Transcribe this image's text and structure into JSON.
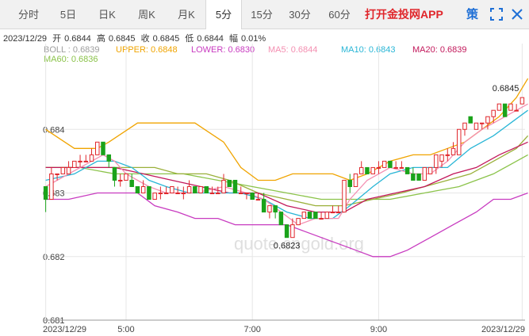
{
  "toolbar": {
    "tabs": [
      "分时",
      "5日",
      "日K",
      "周K",
      "月K",
      "5分",
      "15分",
      "30分",
      "60分"
    ],
    "active_tab": "5分",
    "app_link": "打开金投网APP",
    "more_label": "策",
    "icons": [
      "fullscreen-icon",
      "close-icon"
    ]
  },
  "quote": {
    "date": "2023/12/29",
    "open_label": "开",
    "open": "0.6844",
    "high_label": "高",
    "high": "0.6845",
    "close_label": "收",
    "close": "0.6845",
    "low_label": "低",
    "low": "0.6844",
    "change_label": "幅",
    "change": "0.01%"
  },
  "indicators": {
    "boll": "BOLL : 0.6839",
    "upper": "UPPER: 0.6848",
    "lower": "LOWER: 0.6830",
    "ma5": "MA5: 0.6844",
    "ma10": "MA10: 0.6843",
    "ma20": "MA20: 0.6839",
    "ma60": "MA60: 0.6836"
  },
  "watermark": "quote.cngold.org",
  "colors": {
    "up": "#e0262b",
    "down": "#1aa31a",
    "upper": "#f0a400",
    "lower": "#c83bc0",
    "boll": "#9ab03a",
    "ma5": "#f48fb1",
    "ma10": "#29b6d6",
    "ma20": "#c2185b",
    "ma60": "#8bc34a",
    "grid": "#e6e6e6",
    "accent": "#e0262b",
    "brand": "#1e6fd6"
  },
  "chart_data": {
    "type": "candlestick",
    "y_ticks": [
      0.681,
      0.682,
      0.683,
      0.684
    ],
    "ylim": [
      0.681,
      0.6851
    ],
    "x_ticks": [
      "2023/12/29",
      "5:00",
      "7:00",
      "9:00",
      "2023/12/29"
    ],
    "max_label": "0.6845",
    "min_label": "0.6823",
    "candles": [
      [
        0.6831,
        0.6831,
        0.6827,
        0.6829
      ],
      [
        0.6829,
        0.6834,
        0.6829,
        0.6833
      ],
      [
        0.6833,
        0.6833,
        0.6832,
        0.6833
      ],
      [
        0.6833,
        0.6834,
        0.6833,
        0.6834
      ],
      [
        0.6833,
        0.6835,
        0.6833,
        0.6834
      ],
      [
        0.6834,
        0.6835,
        0.6834,
        0.6835
      ],
      [
        0.6835,
        0.6836,
        0.6834,
        0.6835
      ],
      [
        0.6835,
        0.6836,
        0.6835,
        0.6835
      ],
      [
        0.6835,
        0.6837,
        0.6835,
        0.6836
      ],
      [
        0.6836,
        0.6838,
        0.6836,
        0.6838
      ],
      [
        0.6838,
        0.6838,
        0.6836,
        0.6836
      ],
      [
        0.6836,
        0.6835,
        0.6834,
        0.6835
      ],
      [
        0.6834,
        0.6834,
        0.6831,
        0.6832
      ],
      [
        0.6832,
        0.6833,
        0.6831,
        0.6832
      ],
      [
        0.6832,
        0.6833,
        0.6832,
        0.6833
      ],
      [
        0.6832,
        0.6833,
        0.6831,
        0.6831
      ],
      [
        0.6831,
        0.6831,
        0.683,
        0.683
      ],
      [
        0.683,
        0.6832,
        0.683,
        0.6831
      ],
      [
        0.6831,
        0.6831,
        0.6829,
        0.6829
      ],
      [
        0.6829,
        0.683,
        0.6829,
        0.683
      ],
      [
        0.683,
        0.6831,
        0.6829,
        0.683
      ],
      [
        0.683,
        0.6831,
        0.683,
        0.683
      ],
      [
        0.683,
        0.6831,
        0.683,
        0.6831
      ],
      [
        0.683,
        0.6831,
        0.683,
        0.683
      ],
      [
        0.683,
        0.6831,
        0.6829,
        0.683
      ],
      [
        0.683,
        0.6832,
        0.683,
        0.6831
      ],
      [
        0.6831,
        0.6831,
        0.683,
        0.683
      ],
      [
        0.683,
        0.6831,
        0.683,
        0.6831
      ],
      [
        0.6831,
        0.6831,
        0.683,
        0.683
      ],
      [
        0.683,
        0.6831,
        0.683,
        0.683
      ],
      [
        0.683,
        0.6831,
        0.683,
        0.683
      ],
      [
        0.683,
        0.6833,
        0.683,
        0.6832
      ],
      [
        0.6832,
        0.6832,
        0.6831,
        0.6831
      ],
      [
        0.6832,
        0.6832,
        0.683,
        0.683
      ],
      [
        0.683,
        0.6831,
        0.683,
        0.683
      ],
      [
        0.683,
        0.683,
        0.6829,
        0.683
      ],
      [
        0.683,
        0.683,
        0.6829,
        0.6829
      ],
      [
        0.6829,
        0.683,
        0.6829,
        0.6829
      ],
      [
        0.6829,
        0.683,
        0.6827,
        0.6827
      ],
      [
        0.6827,
        0.6828,
        0.6826,
        0.6828
      ],
      [
        0.6828,
        0.6828,
        0.6826,
        0.6827
      ],
      [
        0.6827,
        0.6827,
        0.6825,
        0.6825
      ],
      [
        0.6825,
        0.6825,
        0.6823,
        0.6823
      ],
      [
        0.6823,
        0.6826,
        0.6823,
        0.6825
      ],
      [
        0.6825,
        0.6826,
        0.6825,
        0.6826
      ],
      [
        0.6826,
        0.6827,
        0.6826,
        0.6827
      ],
      [
        0.6827,
        0.6827,
        0.6826,
        0.6826
      ],
      [
        0.6827,
        0.6827,
        0.6826,
        0.6826
      ],
      [
        0.6826,
        0.6827,
        0.6826,
        0.6826
      ],
      [
        0.6826,
        0.6827,
        0.6826,
        0.6827
      ],
      [
        0.6827,
        0.6828,
        0.6827,
        0.6827
      ],
      [
        0.6827,
        0.6828,
        0.6827,
        0.6827
      ],
      [
        0.6827,
        0.6832,
        0.6827,
        0.6832
      ],
      [
        0.6832,
        0.6833,
        0.683,
        0.6831
      ],
      [
        0.6831,
        0.6833,
        0.6831,
        0.6833
      ],
      [
        0.6833,
        0.6835,
        0.6833,
        0.6834
      ],
      [
        0.6834,
        0.6834,
        0.6833,
        0.6833
      ],
      [
        0.6833,
        0.6834,
        0.6833,
        0.6834
      ],
      [
        0.6834,
        0.6835,
        0.6833,
        0.6834
      ],
      [
        0.6834,
        0.6835,
        0.6834,
        0.6835
      ],
      [
        0.6835,
        0.6835,
        0.6834,
        0.6834
      ],
      [
        0.6834,
        0.6835,
        0.6834,
        0.6834
      ],
      [
        0.6834,
        0.6835,
        0.6834,
        0.6834
      ],
      [
        0.6834,
        0.6834,
        0.6833,
        0.6833
      ],
      [
        0.6833,
        0.6834,
        0.6832,
        0.6832
      ],
      [
        0.6833,
        0.6833,
        0.6832,
        0.6832
      ],
      [
        0.6832,
        0.6834,
        0.6832,
        0.6834
      ],
      [
        0.6833,
        0.6834,
        0.6833,
        0.6834
      ],
      [
        0.6834,
        0.6836,
        0.6833,
        0.6836
      ],
      [
        0.6835,
        0.6836,
        0.6834,
        0.6836
      ],
      [
        0.6836,
        0.6837,
        0.6835,
        0.6836
      ],
      [
        0.6836,
        0.6838,
        0.6836,
        0.6837
      ],
      [
        0.6836,
        0.684,
        0.6836,
        0.684
      ],
      [
        0.684,
        0.6841,
        0.6839,
        0.6841
      ],
      [
        0.6842,
        0.6842,
        0.6841,
        0.6841
      ],
      [
        0.684,
        0.6841,
        0.684,
        0.6841
      ],
      [
        0.6841,
        0.6841,
        0.684,
        0.6841
      ],
      [
        0.6841,
        0.6842,
        0.684,
        0.6842
      ],
      [
        0.6842,
        0.6843,
        0.6841,
        0.6843
      ],
      [
        0.6843,
        0.6844,
        0.6843,
        0.6844
      ],
      [
        0.6844,
        0.6844,
        0.6842,
        0.6842
      ],
      [
        0.6843,
        0.6844,
        0.6843,
        0.6844
      ],
      [
        0.6843,
        0.6844,
        0.6843,
        0.6843
      ],
      [
        0.6844,
        0.6845,
        0.6844,
        0.6845
      ]
    ],
    "upper": [
      [
        0,
        0.684
      ],
      [
        5,
        0.6837
      ],
      [
        9,
        0.6837
      ],
      [
        11,
        0.6838
      ],
      [
        16,
        0.6841
      ],
      [
        22,
        0.6841
      ],
      [
        26,
        0.6841
      ],
      [
        31,
        0.6838
      ],
      [
        34,
        0.6834
      ],
      [
        37,
        0.6832
      ],
      [
        40,
        0.6832
      ],
      [
        43,
        0.6833
      ],
      [
        47,
        0.6833
      ],
      [
        50,
        0.6833
      ],
      [
        53,
        0.6832
      ],
      [
        56,
        0.6833
      ],
      [
        60,
        0.6835
      ],
      [
        64,
        0.6836
      ],
      [
        67,
        0.6836
      ],
      [
        70,
        0.6837
      ],
      [
        73,
        0.6838
      ],
      [
        76,
        0.684
      ],
      [
        79,
        0.6842
      ],
      [
        82,
        0.6845
      ],
      [
        84,
        0.6848
      ]
    ],
    "boll": [
      [
        0,
        0.6834
      ],
      [
        5,
        0.6834
      ],
      [
        10,
        0.6834
      ],
      [
        15,
        0.6834
      ],
      [
        19,
        0.6834
      ],
      [
        23,
        0.6833
      ],
      [
        28,
        0.6833
      ],
      [
        32,
        0.6832
      ],
      [
        37,
        0.683
      ],
      [
        42,
        0.6829
      ],
      [
        47,
        0.6828
      ],
      [
        52,
        0.6828
      ],
      [
        57,
        0.6829
      ],
      [
        62,
        0.683
      ],
      [
        66,
        0.6831
      ],
      [
        70,
        0.6832
      ],
      [
        74,
        0.6833
      ],
      [
        78,
        0.6835
      ],
      [
        82,
        0.6837
      ],
      [
        84,
        0.6839
      ]
    ],
    "lower": [
      [
        0,
        0.6829
      ],
      [
        4,
        0.6829
      ],
      [
        9,
        0.683
      ],
      [
        13,
        0.683
      ],
      [
        16,
        0.683
      ],
      [
        19,
        0.6828
      ],
      [
        23,
        0.6827
      ],
      [
        26,
        0.6826
      ],
      [
        30,
        0.6826
      ],
      [
        33,
        0.6825
      ],
      [
        36,
        0.6825
      ],
      [
        39,
        0.6825
      ],
      [
        42,
        0.6825
      ],
      [
        45,
        0.6824
      ],
      [
        48,
        0.6823
      ],
      [
        51,
        0.6822
      ],
      [
        54,
        0.6821
      ],
      [
        57,
        0.682
      ],
      [
        60,
        0.682
      ],
      [
        63,
        0.6821
      ],
      [
        67,
        0.6823
      ],
      [
        71,
        0.6825
      ],
      [
        75,
        0.6827
      ],
      [
        78,
        0.6829
      ],
      [
        81,
        0.6829
      ],
      [
        84,
        0.683
      ]
    ],
    "ma5": [
      [
        0,
        0.6831
      ],
      [
        4,
        0.6833
      ],
      [
        8,
        0.6835
      ],
      [
        10,
        0.6836
      ],
      [
        12,
        0.6835
      ],
      [
        14,
        0.6833
      ],
      [
        16,
        0.6832
      ],
      [
        18,
        0.6831
      ],
      [
        21,
        0.683
      ],
      [
        26,
        0.683
      ],
      [
        31,
        0.6831
      ],
      [
        35,
        0.683
      ],
      [
        38,
        0.6829
      ],
      [
        41,
        0.6827
      ],
      [
        44,
        0.6825
      ],
      [
        47,
        0.6826
      ],
      [
        51,
        0.6826
      ],
      [
        53,
        0.6829
      ],
      [
        56,
        0.6832
      ],
      [
        60,
        0.6834
      ],
      [
        64,
        0.6833
      ],
      [
        67,
        0.6833
      ],
      [
        70,
        0.6835
      ],
      [
        73,
        0.6838
      ],
      [
        76,
        0.684
      ],
      [
        80,
        0.6842
      ],
      [
        84,
        0.6844
      ]
    ],
    "ma10": [
      [
        0,
        0.6832
      ],
      [
        5,
        0.6833
      ],
      [
        9,
        0.6835
      ],
      [
        12,
        0.6835
      ],
      [
        15,
        0.6834
      ],
      [
        18,
        0.6832
      ],
      [
        21,
        0.6831
      ],
      [
        25,
        0.683
      ],
      [
        30,
        0.683
      ],
      [
        34,
        0.683
      ],
      [
        38,
        0.6829
      ],
      [
        42,
        0.6827
      ],
      [
        46,
        0.6826
      ],
      [
        50,
        0.6826
      ],
      [
        53,
        0.6828
      ],
      [
        57,
        0.6831
      ],
      [
        60,
        0.6833
      ],
      [
        64,
        0.6834
      ],
      [
        67,
        0.6834
      ],
      [
        70,
        0.6834
      ],
      [
        74,
        0.6837
      ],
      [
        78,
        0.6839
      ],
      [
        81,
        0.6841
      ],
      [
        84,
        0.6843
      ]
    ],
    "ma20": [
      [
        0,
        0.6834
      ],
      [
        6,
        0.6834
      ],
      [
        12,
        0.6834
      ],
      [
        17,
        0.6833
      ],
      [
        22,
        0.6832
      ],
      [
        27,
        0.6831
      ],
      [
        32,
        0.683
      ],
      [
        37,
        0.683
      ],
      [
        42,
        0.6828
      ],
      [
        47,
        0.6827
      ],
      [
        52,
        0.6827
      ],
      [
        56,
        0.6829
      ],
      [
        61,
        0.683
      ],
      [
        66,
        0.6831
      ],
      [
        71,
        0.6833
      ],
      [
        75,
        0.6834
      ],
      [
        79,
        0.6836
      ],
      [
        84,
        0.6838
      ]
    ],
    "ma60": [
      [
        0,
        0.6834
      ],
      [
        6,
        0.6834
      ],
      [
        12,
        0.6833
      ],
      [
        18,
        0.6833
      ],
      [
        24,
        0.6833
      ],
      [
        30,
        0.6832
      ],
      [
        36,
        0.6831
      ],
      [
        42,
        0.683
      ],
      [
        48,
        0.6829
      ],
      [
        54,
        0.6829
      ],
      [
        60,
        0.6829
      ],
      [
        66,
        0.683
      ],
      [
        72,
        0.6831
      ],
      [
        78,
        0.6833
      ],
      [
        84,
        0.6836
      ]
    ]
  }
}
